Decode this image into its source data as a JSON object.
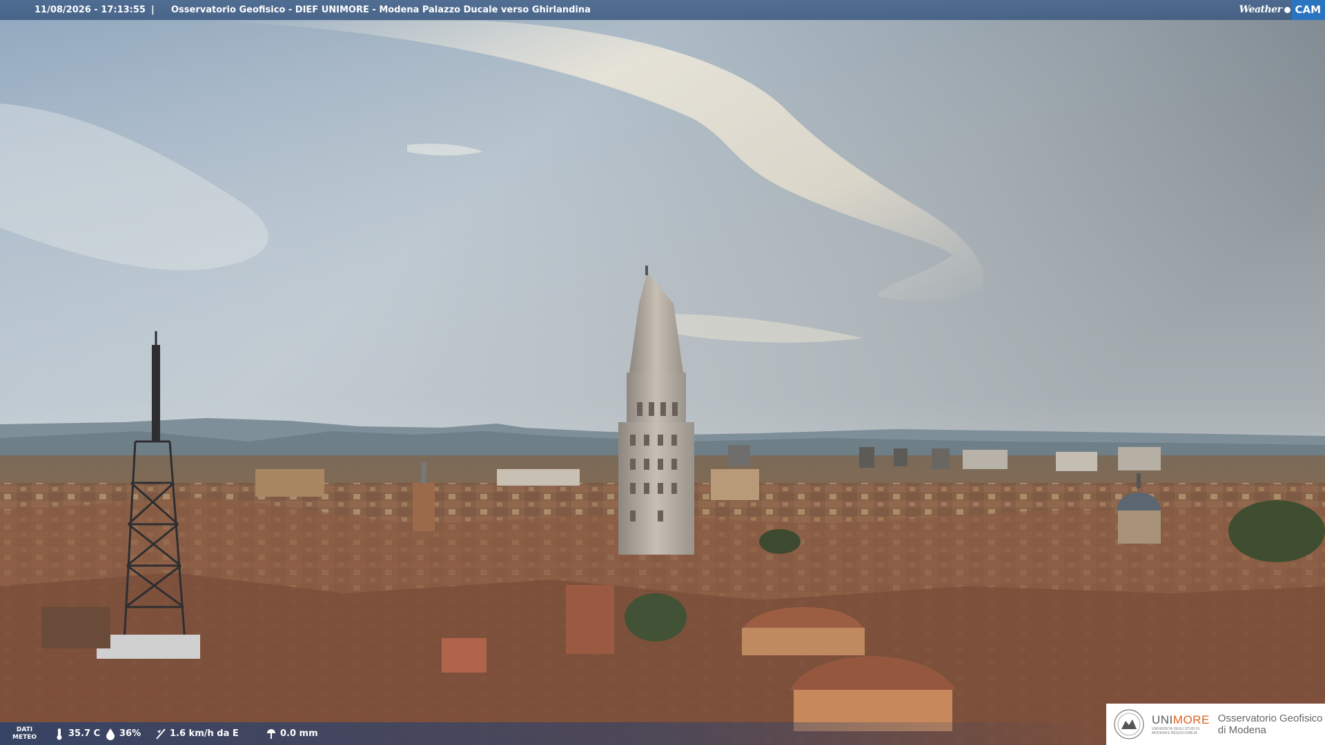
{
  "header": {
    "timestamp": "11/08/2026 - 17:13:55",
    "separator": "|",
    "title": "Osservatorio Geofisico - DIEF UNIMORE - Modena Palazzo Ducale verso Ghirlandina",
    "logo_weather": "Weather",
    "logo_cam": "CAM"
  },
  "weather": {
    "label_line1": "DATI",
    "label_line2": "METEO",
    "temperature": "35.7 C",
    "humidity": "36%",
    "wind": "1.6 km/h da E",
    "rain": "0.0 mm"
  },
  "logo": {
    "uni_prefix": "UNI",
    "uni_suffix": "MORE",
    "uni_sub1": "UNIVERSITÀ DEGLI STUDI DI",
    "uni_sub2": "MODENA E REGGIO EMILIA",
    "obs_line1": "Osservatorio Geofisico",
    "obs_line2": "di Modena"
  },
  "colors": {
    "bar": "#466a8e",
    "cam_blue": "#2a74c0",
    "unimore_orange": "#e06020"
  }
}
